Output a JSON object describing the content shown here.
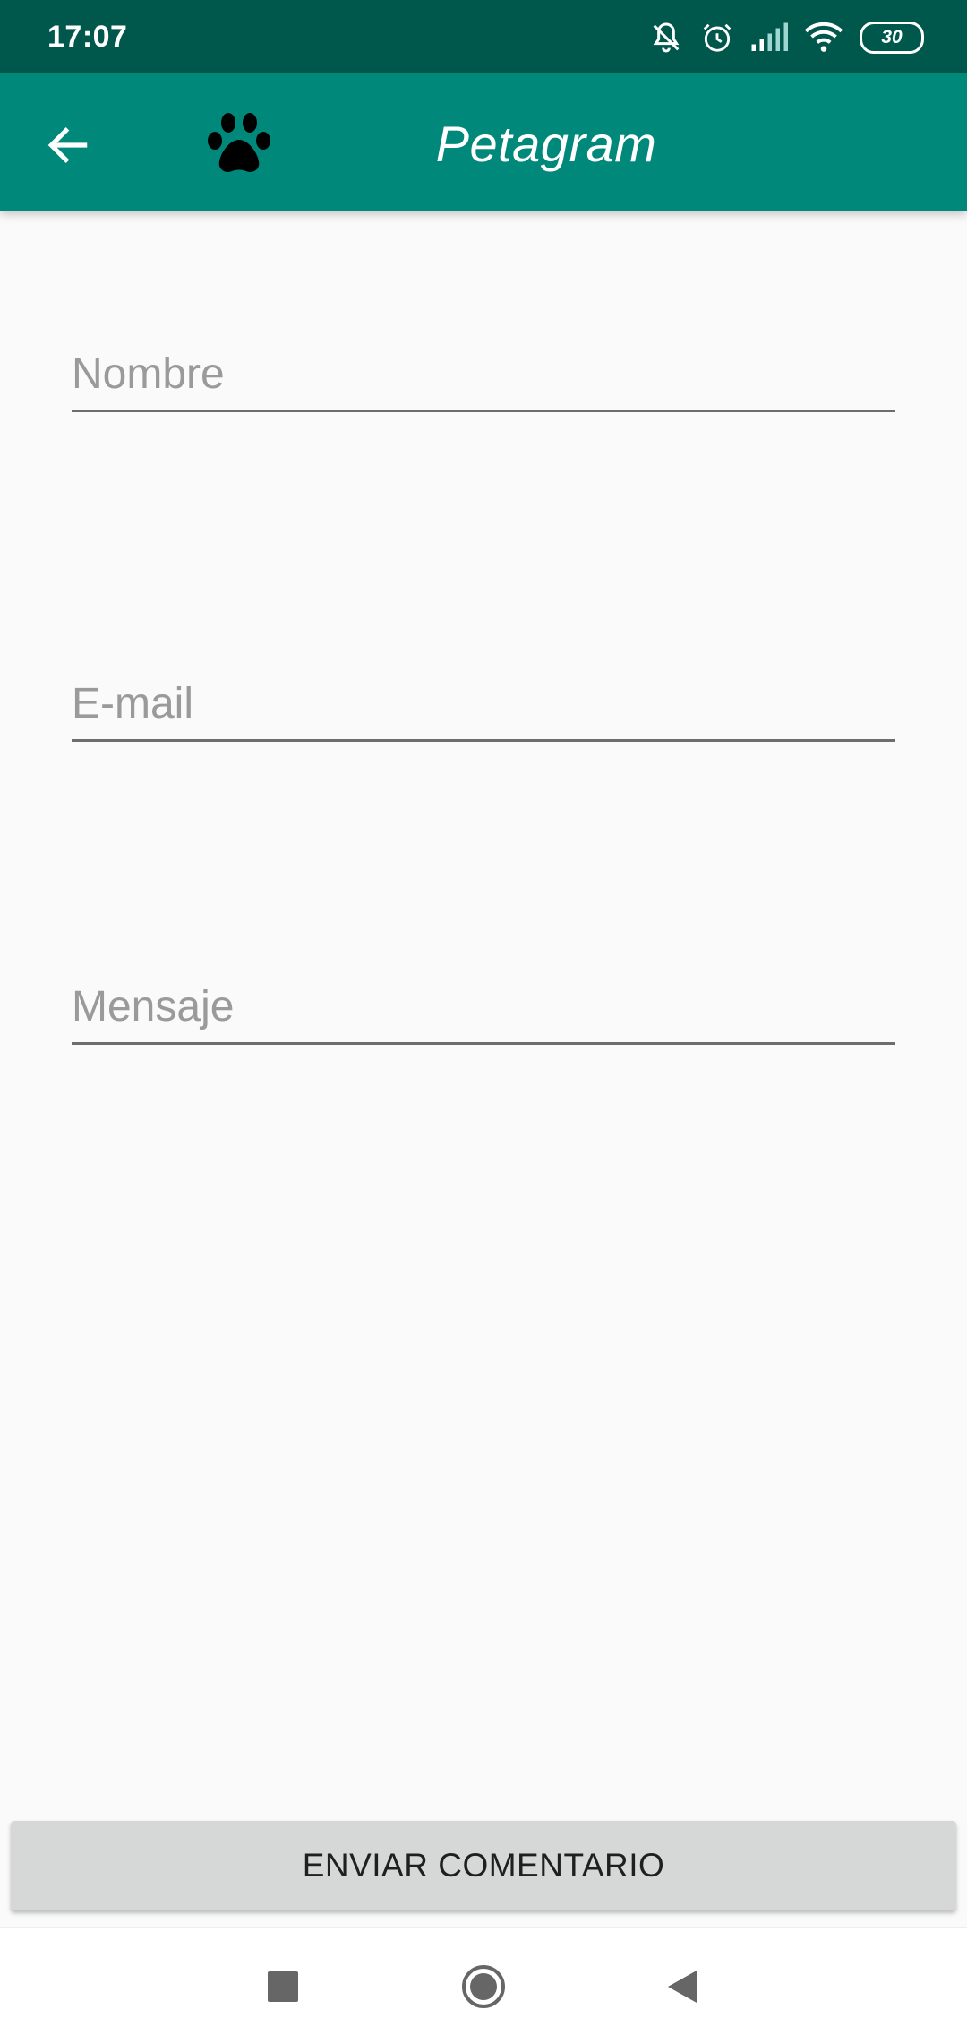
{
  "status_bar": {
    "time": "17:07",
    "battery": "30",
    "icons": [
      "notifications-off-icon",
      "alarm-icon",
      "signal-icon",
      "wifi-icon",
      "battery-icon"
    ]
  },
  "app_bar": {
    "title": "Petagram",
    "back_icon": "arrow-back-icon",
    "logo_icon": "paw-icon",
    "color": "#00897b"
  },
  "form": {
    "name_placeholder": "Nombre",
    "name_value": "",
    "email_placeholder": "E-mail",
    "email_value": "",
    "message_placeholder": "Mensaje",
    "message_value": ""
  },
  "submit_label": "ENVIAR COMENTARIO",
  "nav_bar": {
    "recents_icon": "square-icon",
    "home_icon": "circle-icon",
    "back_icon": "triangle-back-icon"
  }
}
